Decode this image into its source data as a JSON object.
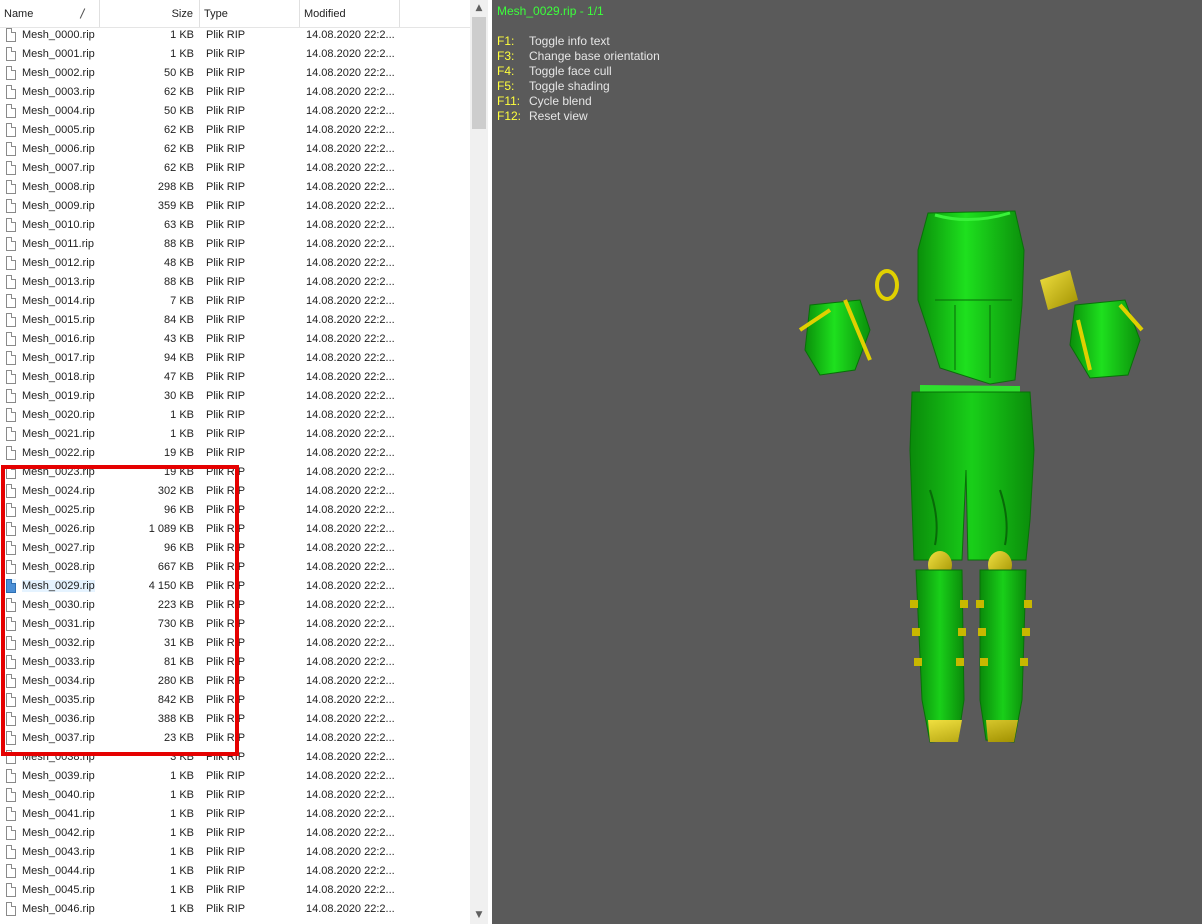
{
  "columns": {
    "name": "Name",
    "size": "Size",
    "type": "Type",
    "modified": "Modified"
  },
  "files": [
    {
      "name": "Mesh_0000.rip",
      "size": "1 KB",
      "type": "Plik RIP",
      "modified": "14.08.2020 22:2..."
    },
    {
      "name": "Mesh_0001.rip",
      "size": "1 KB",
      "type": "Plik RIP",
      "modified": "14.08.2020 22:2..."
    },
    {
      "name": "Mesh_0002.rip",
      "size": "50 KB",
      "type": "Plik RIP",
      "modified": "14.08.2020 22:2..."
    },
    {
      "name": "Mesh_0003.rip",
      "size": "62 KB",
      "type": "Plik RIP",
      "modified": "14.08.2020 22:2..."
    },
    {
      "name": "Mesh_0004.rip",
      "size": "50 KB",
      "type": "Plik RIP",
      "modified": "14.08.2020 22:2..."
    },
    {
      "name": "Mesh_0005.rip",
      "size": "62 KB",
      "type": "Plik RIP",
      "modified": "14.08.2020 22:2..."
    },
    {
      "name": "Mesh_0006.rip",
      "size": "62 KB",
      "type": "Plik RIP",
      "modified": "14.08.2020 22:2..."
    },
    {
      "name": "Mesh_0007.rip",
      "size": "62 KB",
      "type": "Plik RIP",
      "modified": "14.08.2020 22:2..."
    },
    {
      "name": "Mesh_0008.rip",
      "size": "298 KB",
      "type": "Plik RIP",
      "modified": "14.08.2020 22:2..."
    },
    {
      "name": "Mesh_0009.rip",
      "size": "359 KB",
      "type": "Plik RIP",
      "modified": "14.08.2020 22:2..."
    },
    {
      "name": "Mesh_0010.rip",
      "size": "63 KB",
      "type": "Plik RIP",
      "modified": "14.08.2020 22:2..."
    },
    {
      "name": "Mesh_0011.rip",
      "size": "88 KB",
      "type": "Plik RIP",
      "modified": "14.08.2020 22:2..."
    },
    {
      "name": "Mesh_0012.rip",
      "size": "48 KB",
      "type": "Plik RIP",
      "modified": "14.08.2020 22:2..."
    },
    {
      "name": "Mesh_0013.rip",
      "size": "88 KB",
      "type": "Plik RIP",
      "modified": "14.08.2020 22:2..."
    },
    {
      "name": "Mesh_0014.rip",
      "size": "7 KB",
      "type": "Plik RIP",
      "modified": "14.08.2020 22:2..."
    },
    {
      "name": "Mesh_0015.rip",
      "size": "84 KB",
      "type": "Plik RIP",
      "modified": "14.08.2020 22:2..."
    },
    {
      "name": "Mesh_0016.rip",
      "size": "43 KB",
      "type": "Plik RIP",
      "modified": "14.08.2020 22:2..."
    },
    {
      "name": "Mesh_0017.rip",
      "size": "94 KB",
      "type": "Plik RIP",
      "modified": "14.08.2020 22:2..."
    },
    {
      "name": "Mesh_0018.rip",
      "size": "47 KB",
      "type": "Plik RIP",
      "modified": "14.08.2020 22:2..."
    },
    {
      "name": "Mesh_0019.rip",
      "size": "30 KB",
      "type": "Plik RIP",
      "modified": "14.08.2020 22:2..."
    },
    {
      "name": "Mesh_0020.rip",
      "size": "1 KB",
      "type": "Plik RIP",
      "modified": "14.08.2020 22:2..."
    },
    {
      "name": "Mesh_0021.rip",
      "size": "1 KB",
      "type": "Plik RIP",
      "modified": "14.08.2020 22:2..."
    },
    {
      "name": "Mesh_0022.rip",
      "size": "19 KB",
      "type": "Plik RIP",
      "modified": "14.08.2020 22:2..."
    },
    {
      "name": "Mesh_0023.rip",
      "size": "19 KB",
      "type": "Plik RIP",
      "modified": "14.08.2020 22:2..."
    },
    {
      "name": "Mesh_0024.rip",
      "size": "302 KB",
      "type": "Plik RIP",
      "modified": "14.08.2020 22:2..."
    },
    {
      "name": "Mesh_0025.rip",
      "size": "96 KB",
      "type": "Plik RIP",
      "modified": "14.08.2020 22:2..."
    },
    {
      "name": "Mesh_0026.rip",
      "size": "1 089 KB",
      "type": "Plik RIP",
      "modified": "14.08.2020 22:2..."
    },
    {
      "name": "Mesh_0027.rip",
      "size": "96 KB",
      "type": "Plik RIP",
      "modified": "14.08.2020 22:2..."
    },
    {
      "name": "Mesh_0028.rip",
      "size": "667 KB",
      "type": "Plik RIP",
      "modified": "14.08.2020 22:2..."
    },
    {
      "name": "Mesh_0029.rip",
      "size": "4 150 KB",
      "type": "Plik RIP",
      "modified": "14.08.2020 22:2...",
      "selected": true
    },
    {
      "name": "Mesh_0030.rip",
      "size": "223 KB",
      "type": "Plik RIP",
      "modified": "14.08.2020 22:2..."
    },
    {
      "name": "Mesh_0031.rip",
      "size": "730 KB",
      "type": "Plik RIP",
      "modified": "14.08.2020 22:2..."
    },
    {
      "name": "Mesh_0032.rip",
      "size": "31 KB",
      "type": "Plik RIP",
      "modified": "14.08.2020 22:2..."
    },
    {
      "name": "Mesh_0033.rip",
      "size": "81 KB",
      "type": "Plik RIP",
      "modified": "14.08.2020 22:2..."
    },
    {
      "name": "Mesh_0034.rip",
      "size": "280 KB",
      "type": "Plik RIP",
      "modified": "14.08.2020 22:2..."
    },
    {
      "name": "Mesh_0035.rip",
      "size": "842 KB",
      "type": "Plik RIP",
      "modified": "14.08.2020 22:2..."
    },
    {
      "name": "Mesh_0036.rip",
      "size": "388 KB",
      "type": "Plik RIP",
      "modified": "14.08.2020 22:2..."
    },
    {
      "name": "Mesh_0037.rip",
      "size": "23 KB",
      "type": "Plik RIP",
      "modified": "14.08.2020 22:2..."
    },
    {
      "name": "Mesh_0038.rip",
      "size": "3 KB",
      "type": "Plik RIP",
      "modified": "14.08.2020 22:2..."
    },
    {
      "name": "Mesh_0039.rip",
      "size": "1 KB",
      "type": "Plik RIP",
      "modified": "14.08.2020 22:2..."
    },
    {
      "name": "Mesh_0040.rip",
      "size": "1 KB",
      "type": "Plik RIP",
      "modified": "14.08.2020 22:2..."
    },
    {
      "name": "Mesh_0041.rip",
      "size": "1 KB",
      "type": "Plik RIP",
      "modified": "14.08.2020 22:2..."
    },
    {
      "name": "Mesh_0042.rip",
      "size": "1 KB",
      "type": "Plik RIP",
      "modified": "14.08.2020 22:2..."
    },
    {
      "name": "Mesh_0043.rip",
      "size": "1 KB",
      "type": "Plik RIP",
      "modified": "14.08.2020 22:2..."
    },
    {
      "name": "Mesh_0044.rip",
      "size": "1 KB",
      "type": "Plik RIP",
      "modified": "14.08.2020 22:2..."
    },
    {
      "name": "Mesh_0045.rip",
      "size": "1 KB",
      "type": "Plik RIP",
      "modified": "14.08.2020 22:2..."
    },
    {
      "name": "Mesh_0046.rip",
      "size": "1 KB",
      "type": "Plik RIP",
      "modified": "14.08.2020 22:2..."
    }
  ],
  "viewer": {
    "title": "Mesh_0029.rip - 1/1",
    "help": [
      {
        "key": "F1:",
        "desc": "Toggle info text"
      },
      {
        "key": "F3:",
        "desc": "Change base orientation"
      },
      {
        "key": "F4:",
        "desc": "Toggle face cull"
      },
      {
        "key": "F5:",
        "desc": "Toggle shading"
      },
      {
        "key": "F11:",
        "desc": "Cycle blend"
      },
      {
        "key": "F12:",
        "desc": "Reset view"
      }
    ]
  },
  "colors": {
    "viewer_bg": "#5a5a5a",
    "title_green": "#3cff3c",
    "hotkey_yellow": "#ffff3c",
    "highlight_red": "#e50000",
    "model_green": "#12b812",
    "model_gold": "#d8c800"
  },
  "icons": {
    "file": "file-icon",
    "scroll_up": "scroll-up-arrow-icon",
    "scroll_down": "scroll-down-arrow-icon"
  }
}
